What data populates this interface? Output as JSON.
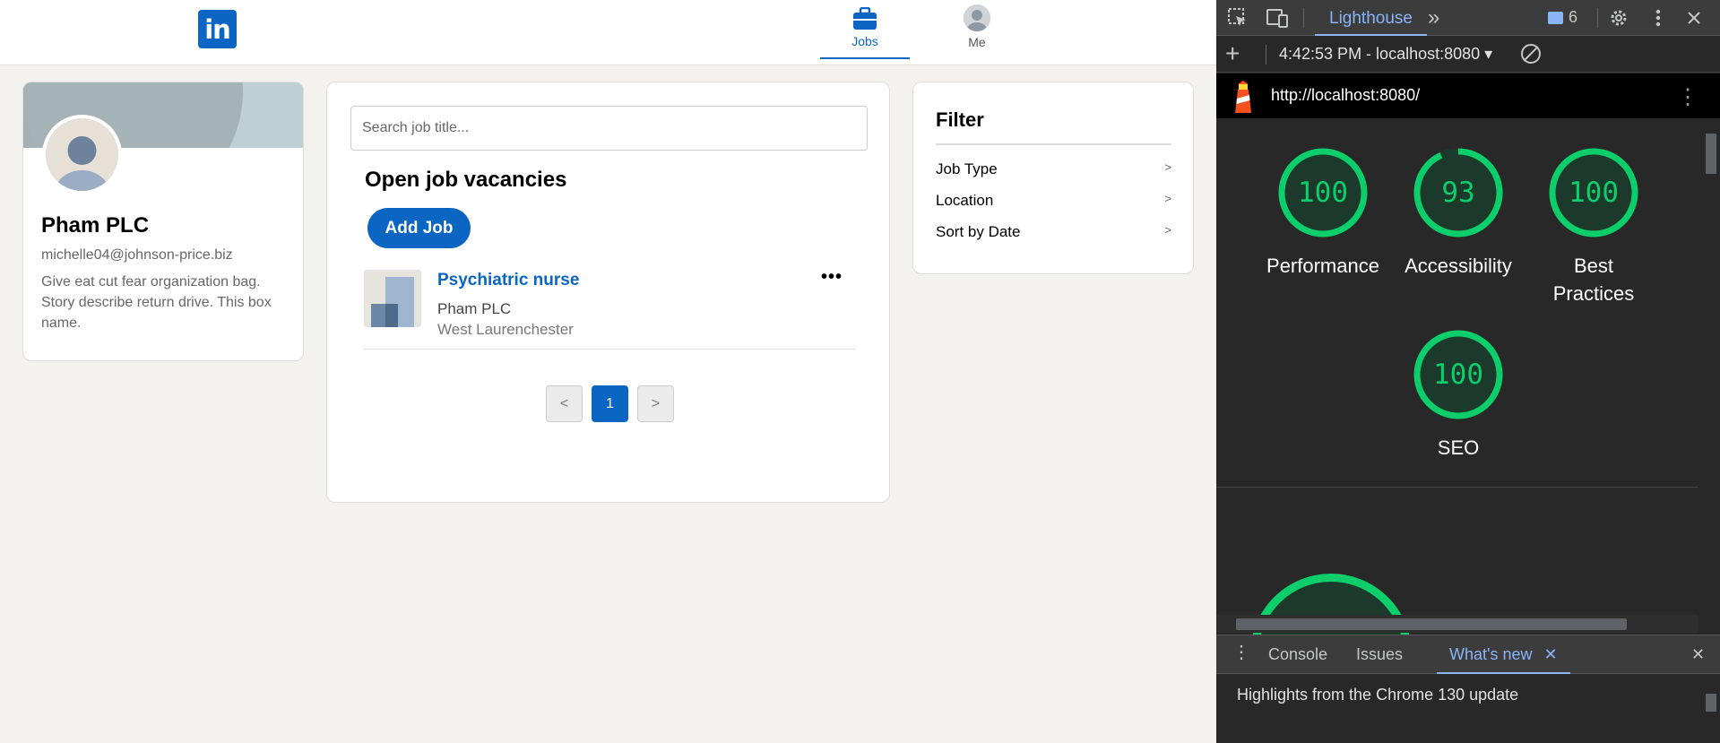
{
  "app": {
    "logo_text": "in",
    "nav": {
      "jobs_label": "Jobs",
      "me_label": "Me"
    },
    "profile": {
      "name": "Pham PLC",
      "email": "michelle04@johnson-price.biz",
      "description": "Give eat cut fear organization bag. Story describe return drive. This box name."
    },
    "jobs": {
      "search_placeholder": "Search job title...",
      "heading": "Open job vacancies",
      "add_button": "Add Job",
      "items": [
        {
          "title": "Psychiatric nurse",
          "company": "Pham PLC",
          "location": "West Laurenchester",
          "more": "•••"
        }
      ],
      "pagination": {
        "prev": "<",
        "current": "1",
        "next": ">"
      }
    },
    "filter": {
      "title": "Filter",
      "options": [
        {
          "label": "Job Type",
          "arrow": ">"
        },
        {
          "label": "Location",
          "arrow": ">"
        },
        {
          "label": "Sort by Date",
          "arrow": ">"
        }
      ]
    },
    "colors": {
      "brand": "#0a66c2",
      "background": "#f3f2ee"
    }
  },
  "devtools": {
    "active_tab": "Lighthouse",
    "more_tabs": "»",
    "message_count": "6",
    "run_label": "4:42:53 PM - localhost:8080 ▾",
    "url": "http://localhost:8080/",
    "scores": [
      {
        "label": "Performance",
        "value": "100"
      },
      {
        "label": "Accessibility",
        "value": "93"
      },
      {
        "label": "Best Practices",
        "value": "100"
      },
      {
        "label": "SEO",
        "value": "100"
      }
    ],
    "drawer": {
      "tabs": [
        "Console",
        "Issues",
        "What's new"
      ],
      "active_tab": "What's new",
      "content": "Highlights from the Chrome 130 update"
    },
    "colors": {
      "pass": "#0cce6b",
      "accent": "#8ab4f8"
    }
  }
}
